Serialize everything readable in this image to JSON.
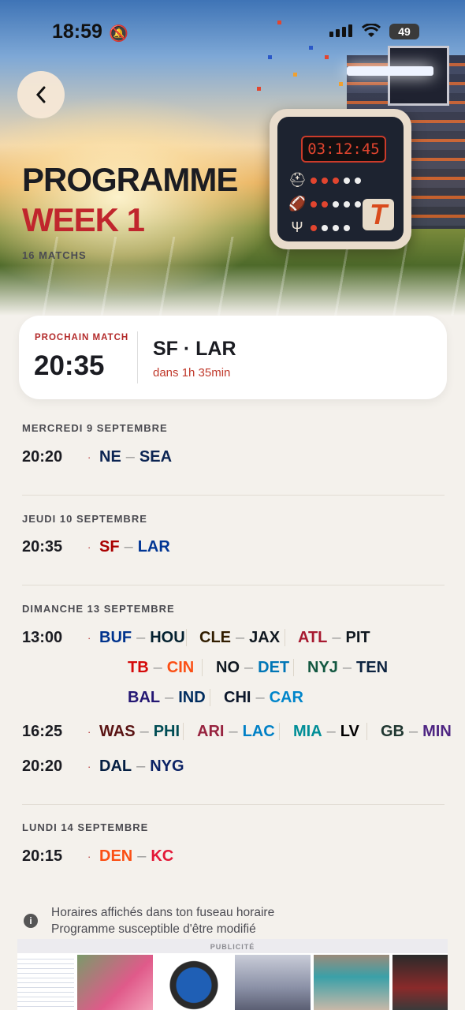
{
  "status_bar": {
    "time": "18:59",
    "battery": "49"
  },
  "header": {
    "title": "PROGRAMME",
    "week": "WEEK 1",
    "match_count": "16 MATCHS",
    "tablet_clock": "03:12:45",
    "tablet_logo": "T"
  },
  "next_match": {
    "label": "PROCHAIN MATCH",
    "time": "20:35",
    "teams": "SF · LAR",
    "countdown": "dans 1h 35min"
  },
  "days": [
    {
      "label": "MERCREDI 9 SEPTEMBRE",
      "slots": [
        {
          "time": "20:20",
          "matches": [
            {
              "home": "NE",
              "away": "SEA"
            }
          ]
        }
      ]
    },
    {
      "label": "JEUDI 10 SEPTEMBRE",
      "slots": [
        {
          "time": "20:35",
          "matches": [
            {
              "home": "SF",
              "away": "LAR"
            }
          ]
        }
      ]
    },
    {
      "label": "DIMANCHE 13 SEPTEMBRE",
      "slots": [
        {
          "time": "13:00",
          "matches": [
            {
              "home": "BUF",
              "away": "HOU"
            },
            {
              "home": "CLE",
              "away": "JAX"
            },
            {
              "home": "ATL",
              "away": "PIT"
            },
            {
              "home": "TB",
              "away": "CIN"
            },
            {
              "home": "NO",
              "away": "DET"
            },
            {
              "home": "NYJ",
              "away": "TEN"
            },
            {
              "home": "BAL",
              "away": "IND"
            },
            {
              "home": "CHI",
              "away": "CAR"
            }
          ]
        },
        {
          "time": "16:25",
          "matches": [
            {
              "home": "WAS",
              "away": "PHI"
            },
            {
              "home": "ARI",
              "away": "LAC"
            },
            {
              "home": "MIA",
              "away": "LV"
            },
            {
              "home": "GB",
              "away": "MIN"
            }
          ]
        },
        {
          "time": "20:20",
          "matches": [
            {
              "home": "DAL",
              "away": "NYG"
            }
          ]
        }
      ]
    },
    {
      "label": "LUNDI 14 SEPTEMBRE",
      "slots": [
        {
          "time": "20:15",
          "matches": [
            {
              "home": "DEN",
              "away": "KC"
            }
          ]
        }
      ]
    }
  ],
  "team_colors": {
    "NE": "#0b2452",
    "SEA": "#0b2452",
    "SF": "#aa0000",
    "LAR": "#003594",
    "BUF": "#00338d",
    "HOU": "#03202f",
    "CLE": "#311d00",
    "JAX": "#101820",
    "ATL": "#a71930",
    "PIT": "#101820",
    "TB": "#d50a0a",
    "CIN": "#fb4f14",
    "NO": "#101820",
    "DET": "#0076b6",
    "NYJ": "#125740",
    "TEN": "#0c2340",
    "BAL": "#241773",
    "IND": "#002c5f",
    "CHI": "#0b162a",
    "CAR": "#0085ca",
    "WAS": "#5a1414",
    "PHI": "#004c54",
    "ARI": "#97233f",
    "LAC": "#0080c6",
    "MIA": "#008e97",
    "LV": "#000000",
    "GB": "#203731",
    "MIN": "#4f2683",
    "DAL": "#041e42",
    "NYG": "#0b2265",
    "DEN": "#fb4f14",
    "KC": "#e31837"
  },
  "footer": {
    "note_line1": "Horaires affichés dans ton fuseau horaire",
    "note_line2": "Programme susceptible d'être modifié",
    "ad_label": "PUBLICITÉ"
  }
}
